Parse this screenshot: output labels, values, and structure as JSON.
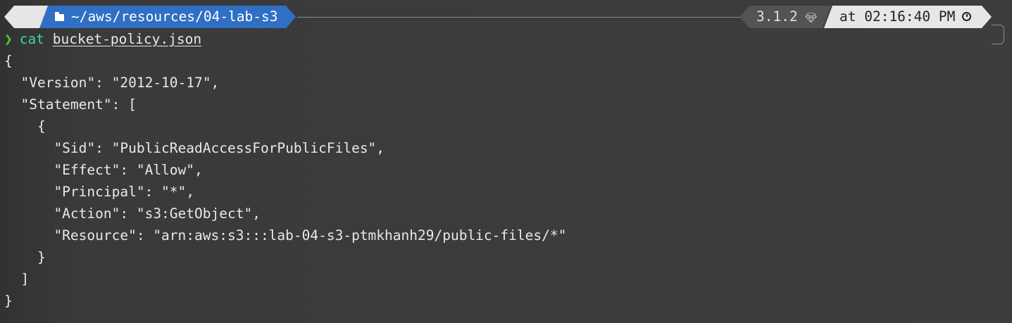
{
  "prompt": {
    "os_icon": "apple-logo-icon",
    "path_icon": "folder-icon",
    "path": "~/aws/resources/04-lab-s3",
    "ruby_version": "3.1.2",
    "ruby_icon": "ruby-gem-icon",
    "time_text": "at 02:16:40 PM",
    "time_icon": "clock-icon"
  },
  "command": {
    "prompt_symbol": "❯",
    "name": "cat",
    "argument": "bucket-policy.json"
  },
  "output_lines": [
    "{",
    "  \"Version\": \"2012-10-17\",",
    "  \"Statement\": [",
    "    {",
    "      \"Sid\": \"PublicReadAccessForPublicFiles\",",
    "      \"Effect\": \"Allow\",",
    "      \"Principal\": \"*\",",
    "      \"Action\": \"s3:GetObject\",",
    "      \"Resource\": \"arn:aws:s3:::lab-04-s3-ptmkhanh29/public-files/*\"",
    "    }",
    "  ]",
    "}"
  ],
  "colors": {
    "background": "#3b3b3b",
    "path_segment": "#2f6fc4",
    "light_segment": "#e6e6e6",
    "version_segment": "#535353",
    "prompt_chevron": "#4bd02b",
    "command": "#3fd3ae"
  }
}
